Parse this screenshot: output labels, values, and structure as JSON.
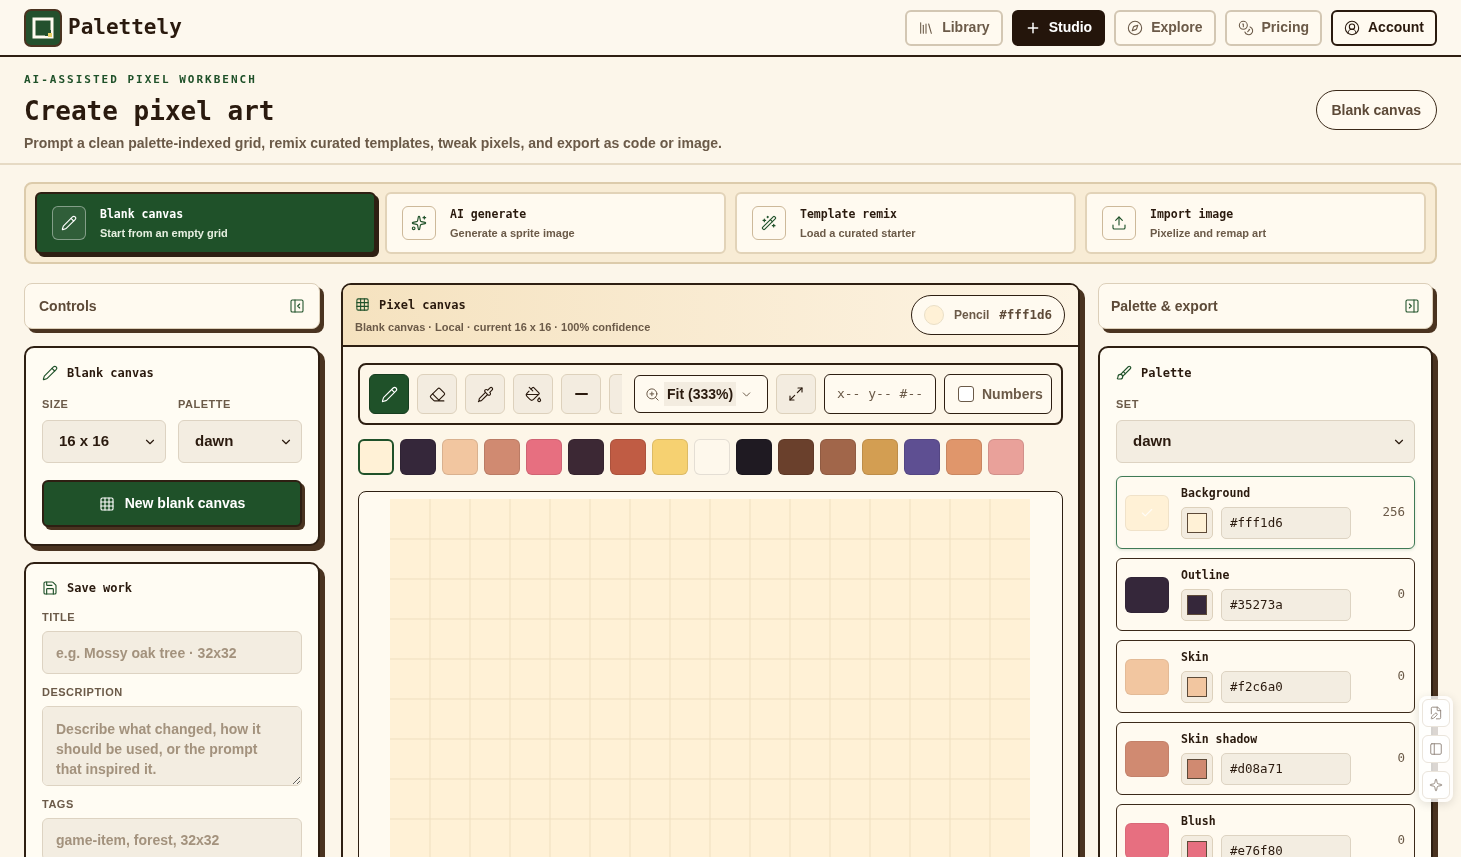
{
  "header": {
    "brand": "Palettely",
    "nav": [
      {
        "label": "Library",
        "kind": "library",
        "selected": false
      },
      {
        "label": "Studio",
        "kind": "studio",
        "selected": true
      },
      {
        "label": "Explore",
        "kind": "explore",
        "selected": false
      },
      {
        "label": "Pricing",
        "kind": "pricing",
        "selected": false
      },
      {
        "label": "Account",
        "kind": "account",
        "selected": false
      }
    ]
  },
  "hero": {
    "eyebrow": "AI-ASSISTED PIXEL WORKBENCH",
    "title": "Create pixel art",
    "subtitle": "Prompt a clean palette-indexed grid, remix curated templates, tweak pixels, and export as code or image.",
    "action": "Blank canvas"
  },
  "modes": [
    {
      "kind": "blank",
      "title": "Blank canvas",
      "subtitle": "Start from an empty grid",
      "selected": true
    },
    {
      "kind": "ai",
      "title": "AI generate",
      "subtitle": "Generate a sprite image",
      "selected": false
    },
    {
      "kind": "template",
      "title": "Template remix",
      "subtitle": "Load a curated starter",
      "selected": false
    },
    {
      "kind": "import",
      "title": "Import image",
      "subtitle": "Pixelize and remap art",
      "selected": false
    }
  ],
  "left": {
    "header": "Controls",
    "blank_card": {
      "title": "Blank canvas",
      "selects": [
        {
          "label": "SIZE",
          "value": "16 x 16"
        },
        {
          "label": "PALETTE",
          "value": "dawn"
        }
      ],
      "button": "New blank canvas"
    },
    "save_card": {
      "title": "Save work",
      "fields": [
        {
          "kind": "input",
          "label": "TITLE",
          "placeholder": "e.g. Mossy oak tree · 32x32"
        },
        {
          "kind": "textarea",
          "label": "DESCRIPTION",
          "placeholder": "Describe what changed, how it should be used, or the prompt that inspired it."
        },
        {
          "kind": "input",
          "label": "TAGS",
          "placeholder": "game-item, forest, 32x32"
        }
      ]
    }
  },
  "canvas": {
    "title": "Pixel canvas",
    "meta": "Blank canvas · Local · current 16 x 16 · 100% confidence",
    "brush": {
      "tool": "Pencil",
      "hex": "#fff1d6",
      "color": "#fff1d6"
    },
    "tools": [
      {
        "kind": "pencil",
        "selected": true
      },
      {
        "kind": "eraser",
        "selected": false
      },
      {
        "kind": "eyedropper",
        "selected": false
      },
      {
        "kind": "fill",
        "selected": false
      },
      {
        "kind": "line",
        "selected": false
      },
      {
        "kind": "partial",
        "selected": false
      }
    ],
    "zoom": "Fit (333%)",
    "readout": "x-- y-- #--",
    "numbers": {
      "label": "Numbers",
      "checked": false
    },
    "swatches": [
      {
        "color": "#fff1d6",
        "selected": true
      },
      {
        "color": "#35273a",
        "selected": false
      },
      {
        "color": "#f2c6a0",
        "selected": false
      },
      {
        "color": "#d08a71",
        "selected": false
      },
      {
        "color": "#e76f80",
        "selected": false
      },
      {
        "color": "#3c2834",
        "selected": false
      },
      {
        "color": "#c05c44",
        "selected": false
      },
      {
        "color": "#f6d171",
        "selected": false
      },
      {
        "color": "#fef8ec",
        "selected": false
      },
      {
        "color": "#1f1a22",
        "selected": false
      },
      {
        "color": "#6a402c",
        "selected": false
      },
      {
        "color": "#a1664a",
        "selected": false
      },
      {
        "color": "#d39e52",
        "selected": false
      },
      {
        "color": "#5e4f92",
        "selected": false
      },
      {
        "color": "#e0966b",
        "selected": false
      },
      {
        "color": "#e9a19a",
        "selected": false
      }
    ]
  },
  "right": {
    "header": "Palette & export",
    "palette_card": {
      "title": "Palette",
      "set": {
        "label": "SET",
        "value": "dawn"
      },
      "colors": [
        {
          "name": "Background",
          "hex": "#fff1d6",
          "color": "#fff1d6",
          "count": "256",
          "selected": true
        },
        {
          "name": "Outline",
          "hex": "#35273a",
          "color": "#35273a",
          "count": "0",
          "selected": false
        },
        {
          "name": "Skin",
          "hex": "#f2c6a0",
          "color": "#f2c6a0",
          "count": "0",
          "selected": false
        },
        {
          "name": "Skin shadow",
          "hex": "#d08a71",
          "color": "#d08a71",
          "count": "0",
          "selected": false
        },
        {
          "name": "Blush",
          "hex": "#e76f80",
          "color": "#e76f80",
          "count": "0",
          "selected": false
        }
      ]
    }
  }
}
